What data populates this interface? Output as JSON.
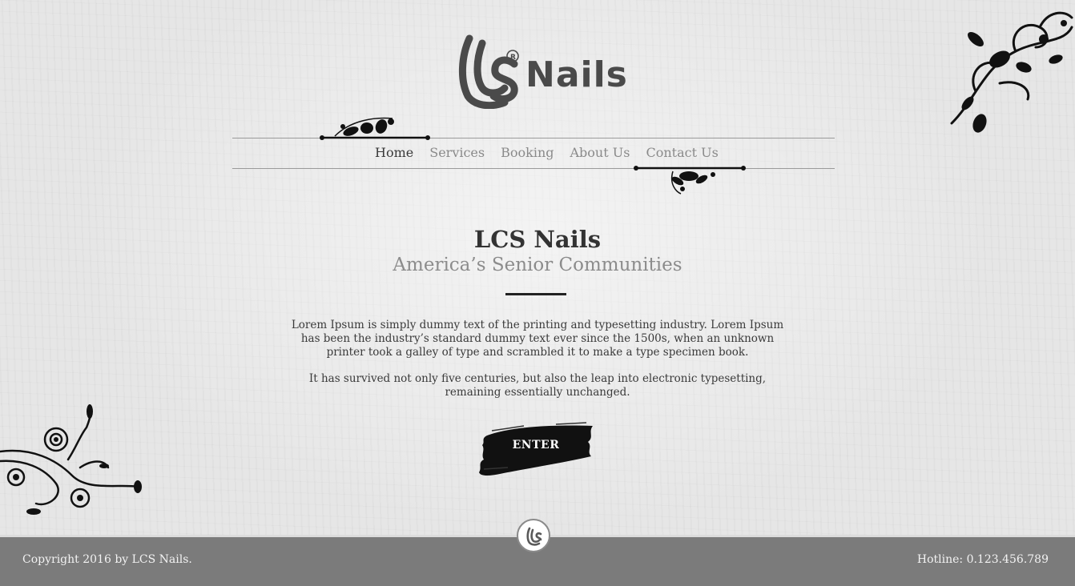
{
  "brand": {
    "logo_mark": "LCS",
    "logo_text": "Nails",
    "registered": "®"
  },
  "nav": {
    "items": [
      {
        "label": "Home",
        "active": true
      },
      {
        "label": "Services",
        "active": false
      },
      {
        "label": "Booking",
        "active": false
      },
      {
        "label": "About Us",
        "active": false
      },
      {
        "label": "Contact Us",
        "active": false
      }
    ]
  },
  "hero": {
    "title": "LCS Nails",
    "subtitle": "America’s Senior Communities",
    "paragraph1": "Lorem Ipsum is simply dummy text of the printing and typesetting industry. Lorem Ipsum has been the industry’s standard dummy text ever since the 1500s, when an unknown printer took a galley of type and scrambled it to make a type specimen book.",
    "paragraph2": "It has survived not only five centuries, but also the leap into electronic typesetting, remaining essentially unchanged.",
    "enter_label": "ENTER"
  },
  "footer": {
    "copyright": "Copyright 2016 by LCS Nails.",
    "hotline": "Hotline: 0.123.456.789"
  },
  "colors": {
    "accent": "#222222",
    "footer_bg": "#7b7b7b",
    "nav_active": "#3a3a3a",
    "nav_inactive": "#8a8a8a"
  },
  "icons": [
    "lcs-logo-icon",
    "floral-ornament-icon",
    "swirl-ornament-icon",
    "brush-stroke-icon"
  ]
}
